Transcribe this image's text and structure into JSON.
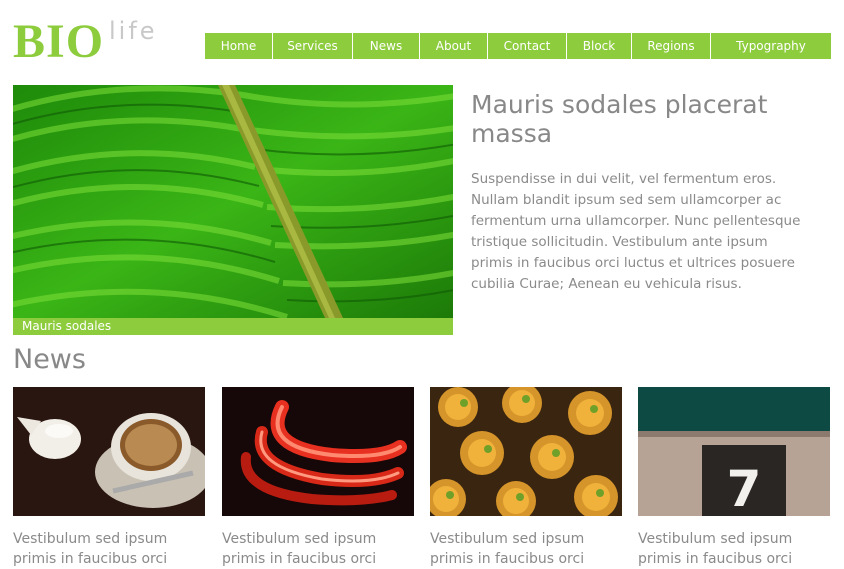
{
  "logo": {
    "bold": "BIO",
    "light": "life"
  },
  "nav": {
    "items": [
      {
        "label": "Home"
      },
      {
        "label": "Services"
      },
      {
        "label": "News"
      },
      {
        "label": "About"
      },
      {
        "label": "Contact"
      },
      {
        "label": "Block"
      },
      {
        "label": "Regions"
      },
      {
        "label": "Typography"
      }
    ]
  },
  "hero": {
    "caption": "Mauris sodales"
  },
  "feature": {
    "title": "Mauris sodales placerat massa",
    "body": "Suspendisse in dui velit, vel fermentum eros. Nullam blandit ipsum sed sem ullamcorper ac fermentum urna ullamcorper. Nunc pellentesque tristique sollicitudin. Vestibulum ante ipsum primis in faucibus orci luctus et ultrices posuere cubilia Curae; Aenean eu vehicula risus."
  },
  "news": {
    "heading": "News",
    "items": [
      {
        "text": "Vestibulum sed ipsum primis in faucibus orci"
      },
      {
        "text": "Vestibulum sed ipsum primis in faucibus orci"
      },
      {
        "text": "Vestibulum sed ipsum primis in faucibus orci"
      },
      {
        "text": "Vestibulum sed ipsum primis in faucibus orci"
      }
    ],
    "thumb3_number": "7"
  },
  "colors": {
    "accent": "#8dcc3d",
    "text": "#888888",
    "logo_light": "#c8c8c8"
  }
}
